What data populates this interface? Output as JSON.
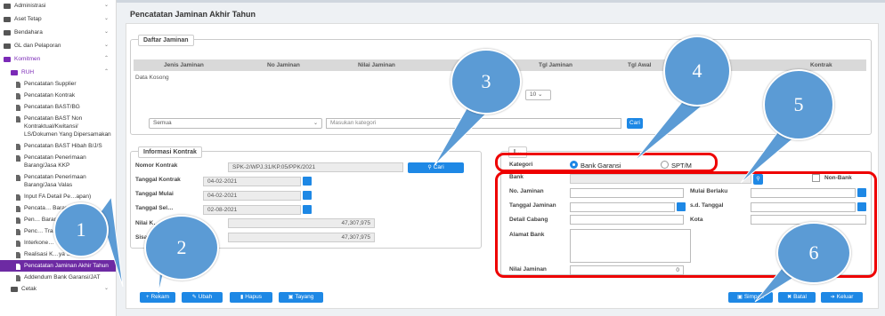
{
  "sidebar": {
    "items": [
      {
        "label": "Administrasi",
        "level": 0,
        "type": "folder",
        "chevron": "⌄"
      },
      {
        "label": "Aset Tetap",
        "level": 0,
        "type": "folder",
        "chevron": "⌄"
      },
      {
        "label": "Bendahara",
        "level": 0,
        "type": "folder",
        "chevron": "⌄"
      },
      {
        "label": "GL dan Pelaporan",
        "level": 0,
        "type": "folder",
        "chevron": "⌄"
      },
      {
        "label": "Komitmen",
        "level": 0,
        "type": "folder",
        "chevron": "⌃",
        "active": true
      },
      {
        "label": "RUH",
        "level": 1,
        "type": "folder",
        "chevron": "⌃",
        "active": true
      },
      {
        "label": "Pencatatan Supplier",
        "level": 2,
        "type": "doc"
      },
      {
        "label": "Pencatatan Kontrak",
        "level": 2,
        "type": "doc"
      },
      {
        "label": "Pencatatan BAST/BG",
        "level": 2,
        "type": "doc"
      },
      {
        "label": "Pencatatan BAST Non Kontraktual/Kwitansi/ LS/Dokumen Yang Dipersamakan",
        "level": 2,
        "type": "doc"
      },
      {
        "label": "Pencatatan BAST Hibah B/J/S",
        "level": 2,
        "type": "doc"
      },
      {
        "label": "Pencatatan Penerimaan Barang/Jasa KKP",
        "level": 2,
        "type": "doc"
      },
      {
        "label": "Pencatatan Penerimaan Barang/Jasa Valas",
        "level": 2,
        "type": "doc"
      },
      {
        "label": "Input FA Detail Pe…apan)",
        "level": 2,
        "type": "doc"
      },
      {
        "label": "Pencata… Barang/J…",
        "level": 2,
        "type": "doc"
      },
      {
        "label": "Pen… Barang/J…",
        "level": 2,
        "type": "doc"
      },
      {
        "label": "Penc… Transitoris",
        "level": 2,
        "type": "doc"
      },
      {
        "label": "Interkone…",
        "level": 2,
        "type": "doc"
      },
      {
        "label": "Realisasi K…ya Satker",
        "level": 2,
        "type": "doc"
      },
      {
        "label": "Pencatatan Jaminan Akhir Tahun",
        "level": 2,
        "type": "doc",
        "selected": true
      },
      {
        "label": "Addendum Bank Garansi/JAT",
        "level": 2,
        "type": "doc"
      },
      {
        "label": "Cetak",
        "level": 1,
        "type": "folder",
        "chevron": "⌄"
      }
    ]
  },
  "page": {
    "title": "Pencatatan Jaminan Akhir Tahun"
  },
  "daftar": {
    "legend": "Daftar Jaminan",
    "columns": [
      "Jenis Jaminan",
      "No Jaminan",
      "Nilai Jaminan",
      "Tgl Jaminan",
      "Tgl Awal",
      "Kontrak"
    ],
    "empty_text": "Data Kosong",
    "page_size": "10",
    "filter_value": "Semua",
    "search_placeholder": "Masukan kategori",
    "search_button": "Cari"
  },
  "kontrak": {
    "legend": "Informasi Kontrak",
    "nomor_label": "Nomor Kontrak",
    "nomor_value": "SPK-2/WPJ.31/KP.05/PPK/2021",
    "cari_button": "Cari",
    "tgl_kontrak_label": "Tanggal Kontrak",
    "tgl_kontrak_value": "04-02-2021",
    "tgl_mulai_label": "Tanggal Mulai",
    "tgl_mulai_value": "04-02-2021",
    "tgl_selesai_label": "Tanggal Sel…",
    "tgl_selesai_value": "02-08-2021",
    "nilai_label": "Nilai K…",
    "nilai_value": "47,307,975",
    "sisa_label": "Sisa…",
    "sisa_value": "47,307,975"
  },
  "jaminan": {
    "legend": "I…",
    "kategori_label": "Kategori",
    "opt_bank": "Bank Garansi",
    "opt_sptm": "SPT/M",
    "bank_label": "Bank",
    "nonbank_label": "Non-Bank",
    "no_label": "No. Jaminan",
    "mulai_label": "Mulai Berlaku",
    "tgl_label": "Tanggal Jaminan",
    "sd_label": "s.d. Tanggal",
    "cabang_label": "Detail Cabang",
    "kota_label": "Kota",
    "alamat_label": "Alamat Bank",
    "nilai_label": "Nilai Jaminan",
    "nilai_value": "0"
  },
  "actions": {
    "rekam": "Rekam",
    "ubah": "Ubah",
    "hapus": "Hapus",
    "tayang": "Tayang",
    "simpan": "Simpan",
    "batal": "Batal",
    "keluar": "Keluar"
  },
  "callouts": [
    "1",
    "2",
    "3",
    "4",
    "5",
    "6"
  ],
  "colors": {
    "accent": "#1e88e5",
    "selected": "#6d2aa3",
    "callout": "#5b9bd5",
    "highlight": "#e00000"
  }
}
